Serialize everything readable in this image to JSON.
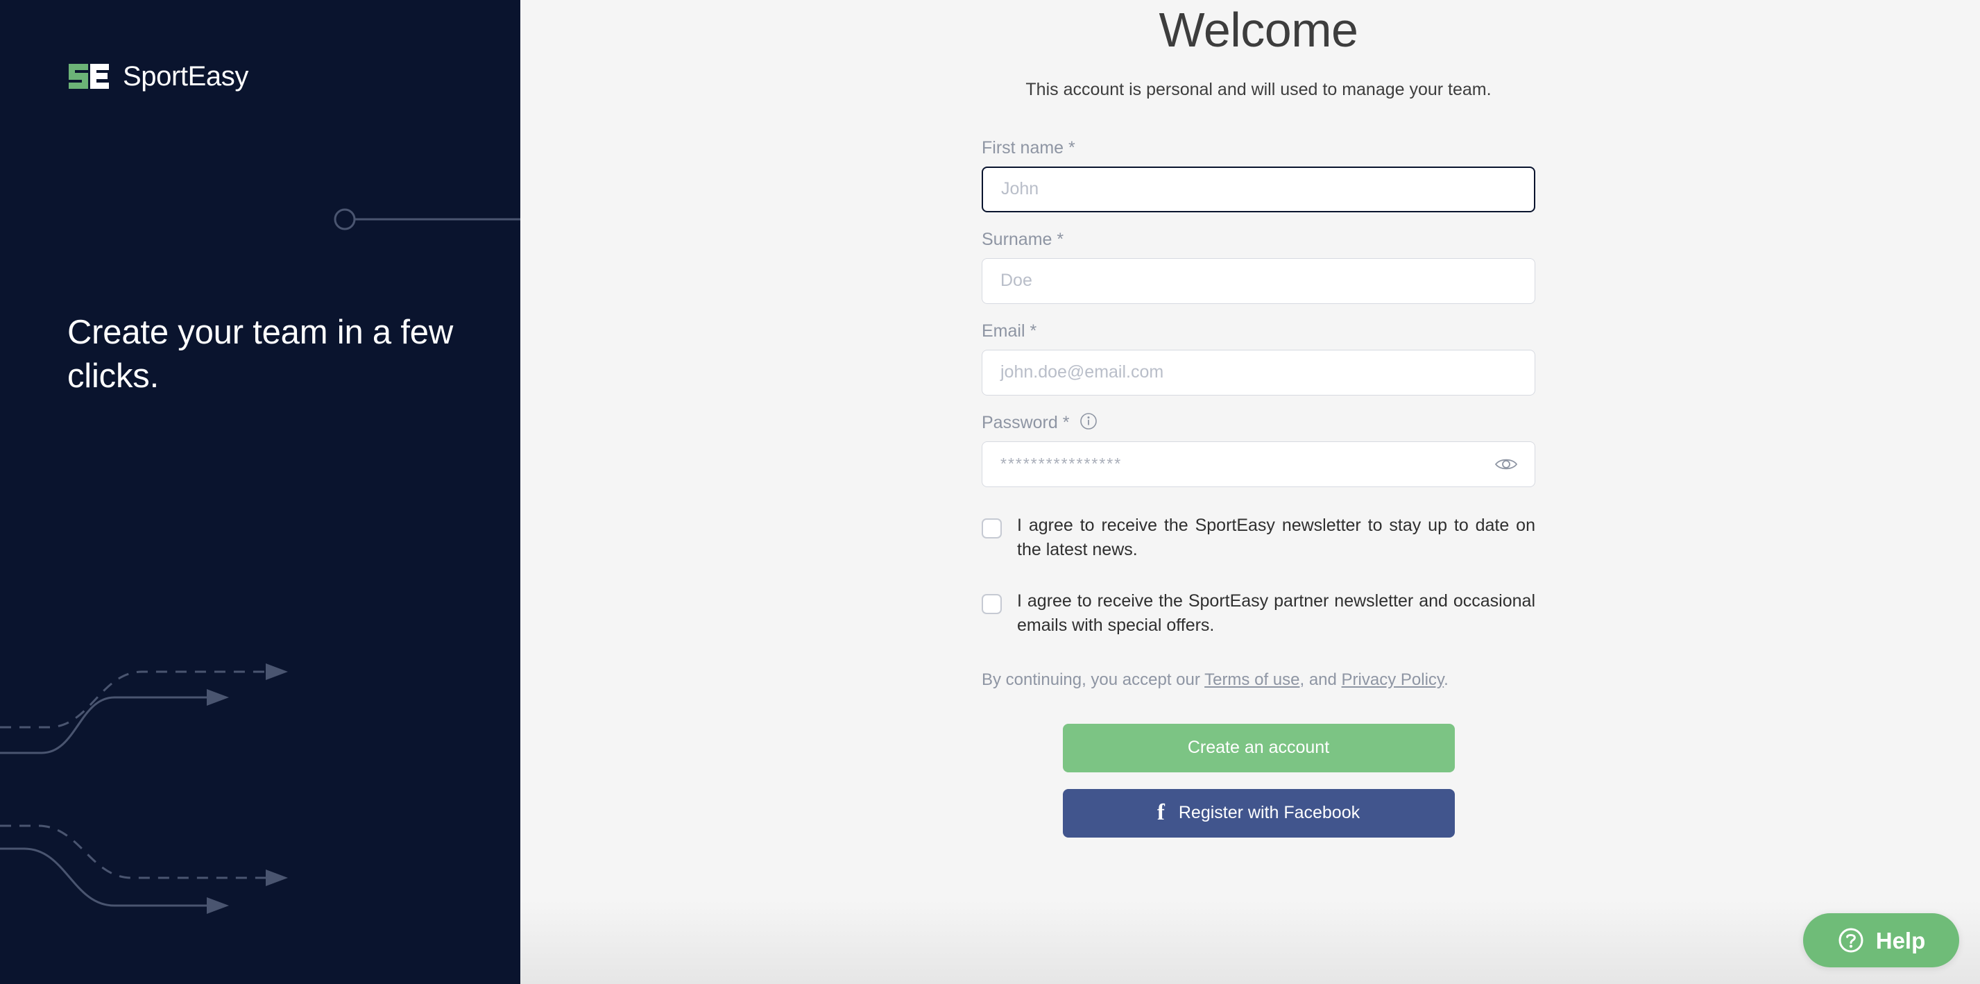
{
  "brand": {
    "name": "SportEasy",
    "logo_letters": "SE",
    "logo_green": "#6cb377",
    "logo_white": "#ffffff"
  },
  "left_panel": {
    "headline": "Create your team in a few clicks.",
    "background_color": "#0a142e"
  },
  "header": {
    "title": "Welcome",
    "subtitle": "This account is personal and will used to manage your team."
  },
  "form": {
    "fields": [
      {
        "label": "First name",
        "required_mark": "*",
        "placeholder": "John",
        "focused": true,
        "type": "text"
      },
      {
        "label": "Surname",
        "required_mark": "*",
        "placeholder": "Doe",
        "focused": false,
        "type": "text"
      },
      {
        "label": "Email",
        "required_mark": "*",
        "placeholder": "john.doe@email.com",
        "focused": false,
        "type": "email"
      },
      {
        "label": "Password",
        "required_mark": "*",
        "placeholder": "****************",
        "focused": false,
        "type": "password",
        "has_info_icon": true,
        "info_icon": "info-circle-icon",
        "toggle_icon": "eye-icon"
      }
    ],
    "checkboxes": [
      {
        "checked": false,
        "label": "I agree to receive the SportEasy newsletter to stay up to date on the latest news."
      },
      {
        "checked": false,
        "label": "I agree to receive the SportEasy partner newsletter and occasional emails with special offers."
      }
    ],
    "terms": {
      "prefix": "By continuing, you accept our ",
      "link_1": "Terms of use",
      "middle": ", and ",
      "link_2": "Privacy Policy",
      "suffix": "."
    },
    "buttons": {
      "primary": {
        "label": "Create an account",
        "color": "#7cc484"
      },
      "facebook": {
        "label": "Register with Facebook",
        "icon": "facebook-f-icon",
        "color": "#41558d"
      }
    }
  },
  "help_widget": {
    "label": "Help",
    "icon": "question-circle-icon",
    "color": "#6fbc78"
  }
}
